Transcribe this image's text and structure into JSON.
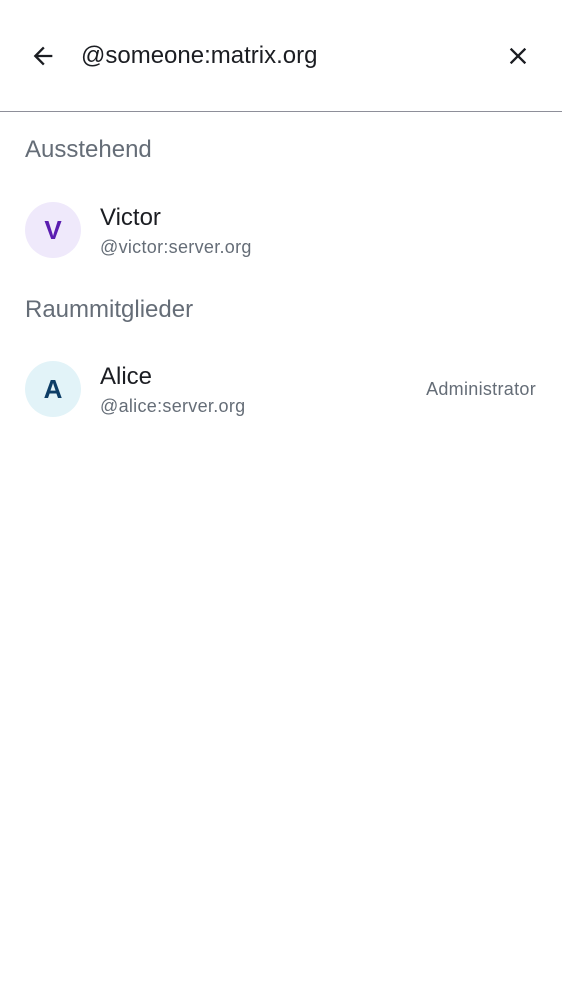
{
  "search": {
    "value": "@someone:matrix.org",
    "back_icon": "arrow-back-icon",
    "clear_icon": "close-icon"
  },
  "sections": {
    "pending": {
      "title": "Ausstehend",
      "members": [
        {
          "initial": "V",
          "name": "Victor",
          "user_id": "@victor:server.org",
          "avatar_bg": "#efe9fb",
          "avatar_fg": "#5a1db0"
        }
      ]
    },
    "joined": {
      "title": "Raummitglieder",
      "members": [
        {
          "initial": "A",
          "name": "Alice",
          "user_id": "@alice:server.org",
          "role": "Administrator",
          "avatar_bg": "#e2f3f8",
          "avatar_fg": "#0d3d66"
        }
      ]
    }
  },
  "colors": {
    "text_primary": "#1b1d22",
    "text_secondary": "#656d77",
    "divider": "#8e8f99"
  }
}
